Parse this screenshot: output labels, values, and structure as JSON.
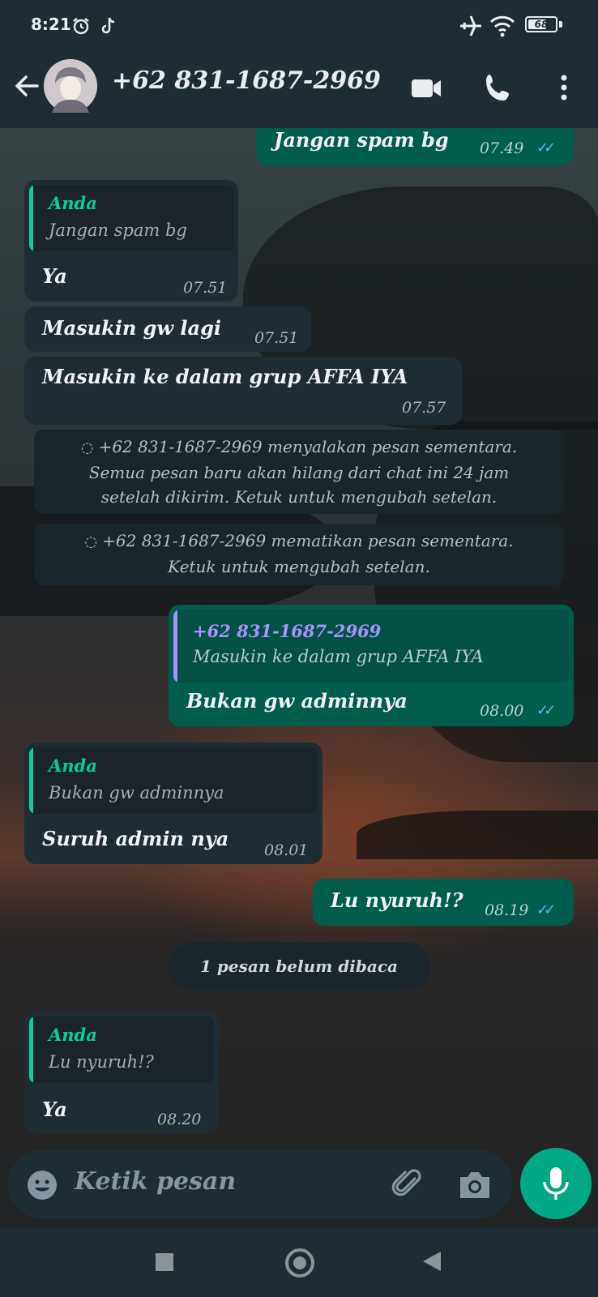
{
  "status_bar": {
    "time": "8:21",
    "battery": "68",
    "battery_level": 0.68
  },
  "header": {
    "contact": "+62 831-1687-2969"
  },
  "messages": [
    {
      "text": "Jangan spam bg",
      "time": "07.49"
    },
    {
      "quote_author": "Anda",
      "quote_text": "Jangan spam bg",
      "text": "Ya",
      "time": "07.51"
    },
    {
      "text": "Masukin gw lagi",
      "time": "07.51"
    },
    {
      "text": "Masukin ke dalam grup AFFA IYA",
      "time": "07.57"
    },
    {
      "quote_author": "+62 831-1687-2969",
      "quote_text": "Masukin ke dalam grup AFFA IYA",
      "text": "Bukan gw adminnya",
      "time": "08.00"
    },
    {
      "quote_author": "Anda",
      "quote_text": "Bukan gw adminnya",
      "text": "Suruh admin nya",
      "time": "08.01"
    },
    {
      "text": "Lu nyuruh!?",
      "time": "08.19"
    },
    {
      "quote_author": "Anda",
      "quote_text": "Lu nyuruh!?",
      "text": "Ya",
      "time": "08.20"
    }
  ],
  "system": {
    "enabled": [
      "+62 831-1687-2969 menyalakan pesan sementara.",
      "Semua pesan baru akan hilang dari chat ini 24 jam",
      "setelah dikirim. Ketuk untuk mengubah setelan."
    ],
    "disabled": [
      "+62 831-1687-2969 mematikan pesan sementara.",
      "Ketuk untuk mengubah setelan."
    ]
  },
  "unread_label": "1 pesan belum dibaca",
  "composer": {
    "placeholder": "Ketik pesan"
  },
  "colors": {
    "header_bg": "#1f2c34",
    "incoming_bubble": "#202c33",
    "outgoing_bubble": "#005c4b",
    "accent": "#00a884",
    "read_ticks": "#53bdeb",
    "quote_you": "#06cf9c",
    "quote_contact": "#a791ff"
  },
  "icons": [
    "alarm-icon",
    "tiktok-icon",
    "airplane-icon",
    "wifi-icon",
    "battery-icon",
    "back-arrow-icon",
    "video-call-icon",
    "phone-icon",
    "more-vert-icon",
    "timer-icon",
    "emoji-icon",
    "attach-icon",
    "camera-icon",
    "mic-icon",
    "nav-recents-icon",
    "nav-home-icon",
    "nav-back-icon"
  ]
}
